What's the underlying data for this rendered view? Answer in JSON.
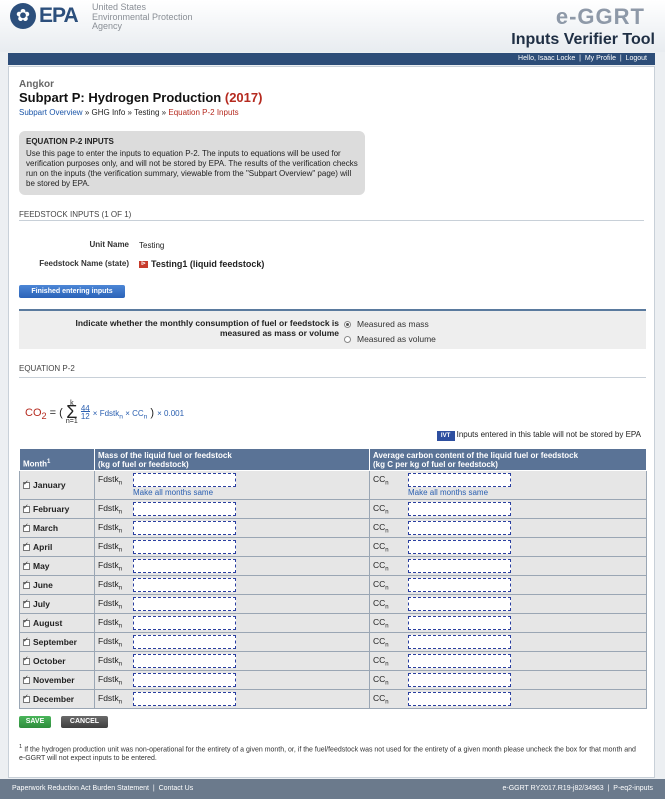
{
  "header": {
    "logo_text": "EPA",
    "agency_lines": [
      "United States",
      "Environmental Protection",
      "Agency"
    ],
    "app_name": "e-GGRT",
    "tool_title": "Inputs Verifier Tool"
  },
  "userbar": {
    "greeting": "Hello, Isaac Locke",
    "separator": "|",
    "my_profile": "My Profile",
    "logout": "Logout"
  },
  "page": {
    "facility": "Angkor",
    "title": "Subpart P: Hydrogen Production",
    "year": "(2017)",
    "breadcrumb": {
      "overview": "Subpart Overview",
      "sep": "»",
      "ghg_info": "GHG Info",
      "testing": "Testing",
      "current": "Equation P-2 Inputs"
    }
  },
  "info": {
    "heading": "EQUATION P-2 INPUTS",
    "body": "Use this page to enter the inputs to equation P-2. The inputs to equations will be used for verification purposes only, and will not be stored by EPA. The results of the verification checks run on the inputs (the verification summary, viewable from the \"Subpart Overview\" page) will be stored by EPA."
  },
  "feedstock": {
    "section_title": "FEEDSTOCK INPUTS (1 OF 1)",
    "unit_name_label": "Unit Name",
    "unit_name_value": "Testing",
    "feedstock_label": "Feedstock Name (state)",
    "feedstock_value": "Testing1 (liquid feedstock)",
    "feedstock_icon": "edit-pin-icon"
  },
  "buttons": {
    "finished": "Finished entering inputs",
    "save": "SAVE",
    "cancel": "CANCEL"
  },
  "measure": {
    "question": "Indicate whether the monthly consumption of fuel or feedstock is measured as mass or volume",
    "options": [
      "Measured as mass",
      "Measured as volume"
    ],
    "selected": "Measured as mass"
  },
  "equation": {
    "section_title": "EQUATION P-2",
    "lhs": "CO",
    "lhs_sub": "2",
    "eq": "=",
    "k": "k",
    "n1": "n=1",
    "frac_num": "44",
    "frac_den": "12",
    "term1": "× Fdstk",
    "term_sub": "n",
    "term2": "× CC",
    "tail": "× 0.001",
    "ivt_badge": "IVT",
    "ivt_note": "Inputs entered in this table will not be stored by EPA"
  },
  "table": {
    "col_month": "Month",
    "col_month_sup": "1",
    "col_mass": "Mass of the liquid fuel or feedstock",
    "col_mass_unit": "(kg of fuel or feedstock)",
    "col_carbon": "Average carbon content of the liquid fuel or feedstock",
    "col_carbon_unit": "(kg C per kg of fuel or feedstock)",
    "var_fdstk": "Fdstk",
    "var_cc": "CC",
    "var_sub": "n",
    "make_all": "Make all months same",
    "months": [
      "January",
      "February",
      "March",
      "April",
      "May",
      "June",
      "July",
      "August",
      "September",
      "October",
      "November",
      "December"
    ]
  },
  "footnote": {
    "marker": "1",
    "text": "If the hydrogen production unit was non-operational for the entirety of a given month, or, if the fuel/feedstock was not used for the entirety of a given month please uncheck the box for that month and e-GGRT will not expect inputs to be entered."
  },
  "footer": {
    "paperwork": "Paperwork Reduction Act Burden Statement",
    "sep": "|",
    "contact": "Contact Us",
    "version": "e-GGRT RY2017.R19-j82/34963",
    "page_id": "P-eq2-inputs"
  }
}
